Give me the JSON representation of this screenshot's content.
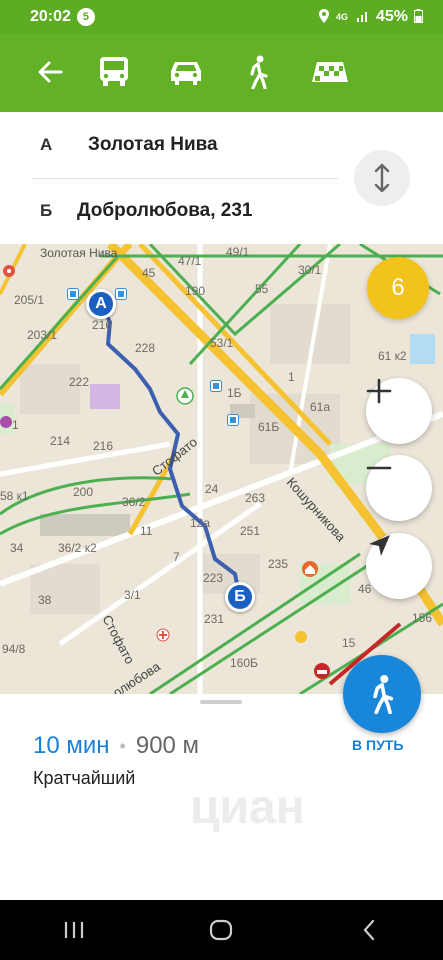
{
  "status_bar": {
    "time": "20:02",
    "notification_count": "5",
    "battery": "45%"
  },
  "transport_bar": {
    "modes": [
      "bus",
      "car",
      "walk",
      "taxi"
    ],
    "selected": "walk",
    "colors": {
      "background": "#63b127",
      "status": "#5cad21"
    }
  },
  "route": {
    "from_letter": "А",
    "from": "Золотая Нива",
    "to_letter": "Б",
    "to": "Добролюбова, 231"
  },
  "map": {
    "traffic_score": "6",
    "marker_a": "А",
    "marker_b": "Б",
    "streets": [
      "Стофато",
      "Стофато",
      "Кошурникова",
      "олюбова"
    ],
    "stop_label": "Золотая Нива",
    "labels": [
      "45",
      "47/1",
      "49/1",
      "30/1",
      "205/1",
      "216",
      "190",
      "55",
      "203/1",
      "228",
      "53/1",
      "222",
      "1Б",
      "1",
      "61 к2",
      "214",
      "216",
      "1",
      "61Б",
      "61а",
      "58 к1",
      "200",
      "24",
      "263",
      "36/2",
      "11",
      "12а",
      "251",
      "34",
      "36/2 к2",
      "7",
      "223",
      "235",
      "46",
      "38",
      "3/1",
      "231",
      "156",
      "94/8",
      "160Б",
      "15"
    ]
  },
  "summary": {
    "duration": "10 мин",
    "separator": "•",
    "distance": "900 м",
    "route_type": "Кратчайший",
    "go_label": "В ПУТЬ",
    "watermark": "циан"
  }
}
